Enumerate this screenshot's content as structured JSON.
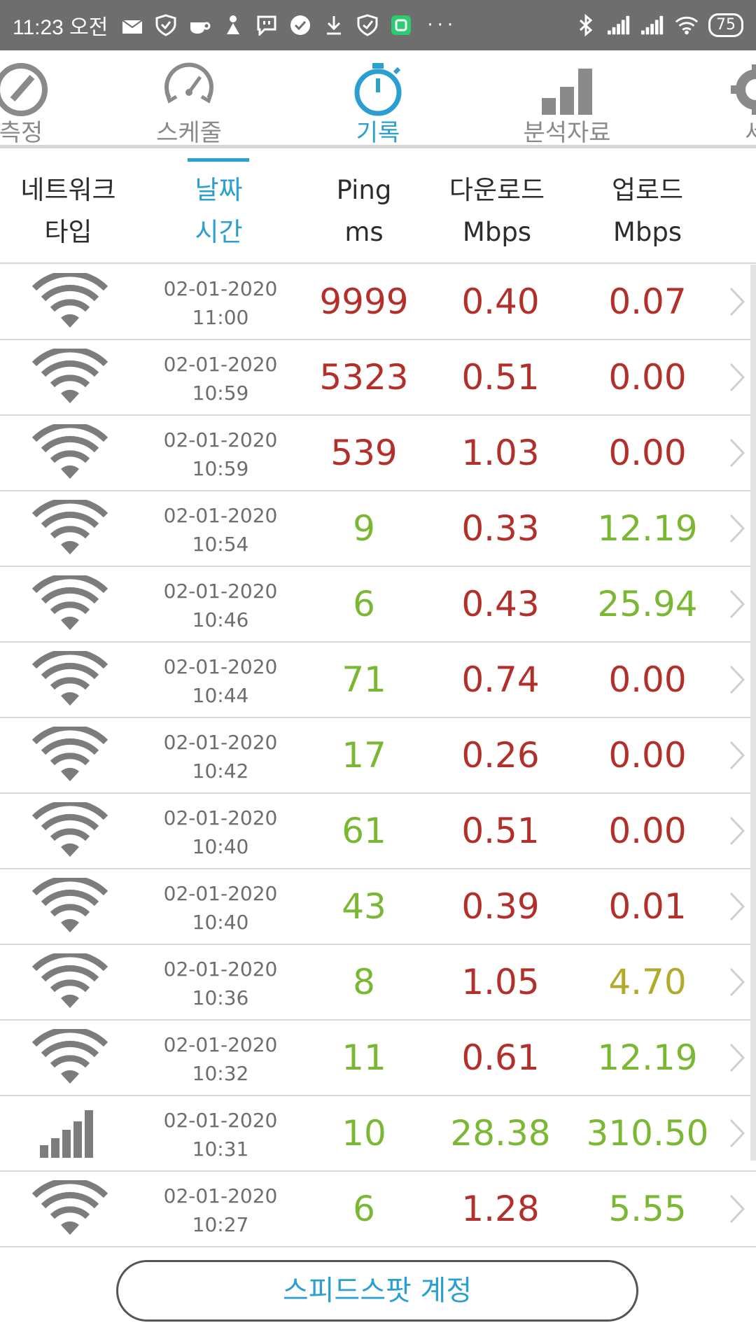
{
  "status_bar": {
    "time": "11:23 오전",
    "battery": "75",
    "icons": [
      "mail-icon",
      "shield-icon",
      "cup-icon",
      "figure-icon",
      "message-icon",
      "check-circle-icon",
      "download-icon",
      "shield-check-icon",
      "app-icon",
      "more-dots-icon",
      "bluetooth-icon",
      "signal-icon",
      "signal-icon",
      "wifi-icon",
      "battery-icon"
    ]
  },
  "tabs": [
    {
      "label": "측정",
      "icon": "gauge-icon",
      "active": false
    },
    {
      "label": "스케줄",
      "icon": "schedule-dial-icon",
      "active": false
    },
    {
      "label": "기록",
      "icon": "stopwatch-icon",
      "active": true
    },
    {
      "label": "분석자료",
      "icon": "bar-chart-icon",
      "active": false
    },
    {
      "label": "세",
      "icon": "gear-icon",
      "active": false
    }
  ],
  "columns": {
    "type": {
      "line1": "네트워크",
      "line2": "타입"
    },
    "date": {
      "line1": "날짜",
      "line2": "시간"
    },
    "ping": {
      "line1": "Ping",
      "line2": "ms"
    },
    "download": {
      "line1": "다운로드",
      "line2": "Mbps"
    },
    "upload": {
      "line1": "업로드",
      "line2": "Mbps"
    }
  },
  "colors": {
    "accent": "#2a9fd0",
    "bad": "#b3302a",
    "good": "#7ab834",
    "medium": "#b1aa2a"
  },
  "rows": [
    {
      "type": "wifi",
      "date": "02-01-2020",
      "time": "11:00",
      "ping": "9999",
      "ping_color": "bad",
      "down": "0.40",
      "down_color": "bad",
      "up": "0.07",
      "up_color": "bad"
    },
    {
      "type": "wifi",
      "date": "02-01-2020",
      "time": "10:59",
      "ping": "5323",
      "ping_color": "bad",
      "down": "0.51",
      "down_color": "bad",
      "up": "0.00",
      "up_color": "bad"
    },
    {
      "type": "wifi",
      "date": "02-01-2020",
      "time": "10:59",
      "ping": "539",
      "ping_color": "bad",
      "down": "1.03",
      "down_color": "bad",
      "up": "0.00",
      "up_color": "bad"
    },
    {
      "type": "wifi",
      "date": "02-01-2020",
      "time": "10:54",
      "ping": "9",
      "ping_color": "good",
      "down": "0.33",
      "down_color": "bad",
      "up": "12.19",
      "up_color": "good"
    },
    {
      "type": "wifi",
      "date": "02-01-2020",
      "time": "10:46",
      "ping": "6",
      "ping_color": "good",
      "down": "0.43",
      "down_color": "bad",
      "up": "25.94",
      "up_color": "good"
    },
    {
      "type": "wifi",
      "date": "02-01-2020",
      "time": "10:44",
      "ping": "71",
      "ping_color": "good",
      "down": "0.74",
      "down_color": "bad",
      "up": "0.00",
      "up_color": "bad"
    },
    {
      "type": "wifi",
      "date": "02-01-2020",
      "time": "10:42",
      "ping": "17",
      "ping_color": "good",
      "down": "0.26",
      "down_color": "bad",
      "up": "0.00",
      "up_color": "bad"
    },
    {
      "type": "wifi",
      "date": "02-01-2020",
      "time": "10:40",
      "ping": "61",
      "ping_color": "good",
      "down": "0.51",
      "down_color": "bad",
      "up": "0.00",
      "up_color": "bad"
    },
    {
      "type": "wifi",
      "date": "02-01-2020",
      "time": "10:40",
      "ping": "43",
      "ping_color": "good",
      "down": "0.39",
      "down_color": "bad",
      "up": "0.01",
      "up_color": "bad"
    },
    {
      "type": "wifi",
      "date": "02-01-2020",
      "time": "10:36",
      "ping": "8",
      "ping_color": "good",
      "down": "1.05",
      "down_color": "bad",
      "up": "4.70",
      "up_color": "medium"
    },
    {
      "type": "wifi",
      "date": "02-01-2020",
      "time": "10:32",
      "ping": "11",
      "ping_color": "good",
      "down": "0.61",
      "down_color": "bad",
      "up": "12.19",
      "up_color": "good"
    },
    {
      "type": "cellular",
      "date": "02-01-2020",
      "time": "10:31",
      "ping": "10",
      "ping_color": "good",
      "down": "28.38",
      "down_color": "good",
      "up": "310.50",
      "up_color": "good"
    },
    {
      "type": "wifi",
      "date": "02-01-2020",
      "time": "10:27",
      "ping": "6",
      "ping_color": "good",
      "down": "1.28",
      "down_color": "bad",
      "up": "5.55",
      "up_color": "good"
    }
  ],
  "account_button": "스피드스팟 계정"
}
